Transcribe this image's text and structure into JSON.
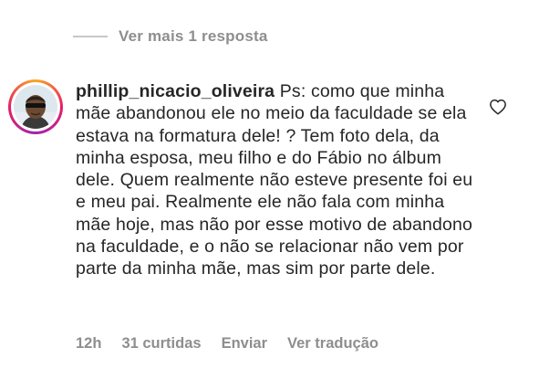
{
  "thread": {
    "view_more_label": "Ver mais 1 resposta"
  },
  "comment": {
    "username": "phillip_nicacio_oliveira",
    "text": "Ps: como que minha mãe abandonou ele no meio da faculdade se ela estava na formatura dele! ? Tem foto dela, da minha esposa, meu filho e do Fábio no álbum dele. Quem realmente não  esteve presente foi eu e meu pai. Realmente ele não fala com minha mãe hoje, mas não por esse motivo de abandono na faculdade, e o não se relacionar não vem por parte da minha mãe, mas sim por parte dele.",
    "like_icon": "heart-outline-icon"
  },
  "meta": {
    "time": "12h",
    "likes": "31 curtidas",
    "reply_label": "Enviar",
    "translate_label": "Ver tradução"
  },
  "colors": {
    "text": "#262626",
    "secondary": "#8e8e8e",
    "divider": "#c7c7c7"
  }
}
